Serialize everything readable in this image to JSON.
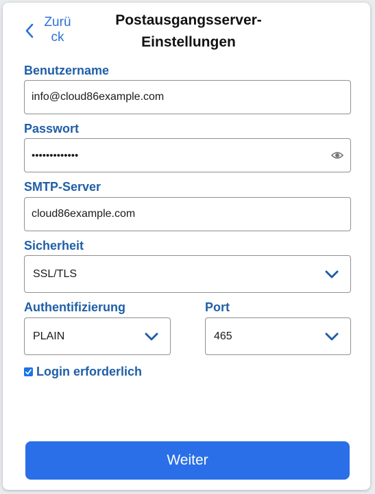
{
  "header": {
    "back_label": "Zurück",
    "title": "Postausgangsserver-Einstellungen"
  },
  "form": {
    "username": {
      "label": "Benutzername",
      "value": "info@cloud86example.com"
    },
    "password": {
      "label": "Passwort",
      "value": "•••••••••••••"
    },
    "smtp_server": {
      "label": "SMTP-Server",
      "value": "cloud86example.com"
    },
    "security": {
      "label": "Sicherheit",
      "selected": "SSL/TLS"
    },
    "authentication": {
      "label": "Authentifizierung",
      "selected": "PLAIN"
    },
    "port": {
      "label": "Port",
      "selected": "465"
    },
    "login_required": {
      "label": "Login erforderlich",
      "checked": true
    }
  },
  "footer": {
    "next_label": "Weiter"
  },
  "colors": {
    "accent": "#2a6fe8",
    "label": "#1f5fa8",
    "back": "#2b71d6"
  },
  "icons": {
    "back": "chevron-left-icon",
    "show_password": "eye-icon",
    "dropdown": "chevron-down-icon",
    "checkbox": "check-icon"
  }
}
